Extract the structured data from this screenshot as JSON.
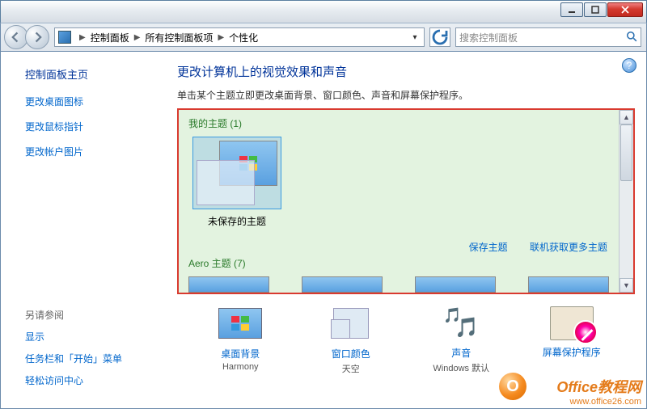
{
  "breadcrumb": {
    "root": "控制面板",
    "mid": "所有控制面板项",
    "leaf": "个性化"
  },
  "search": {
    "placeholder": "搜索控制面板"
  },
  "sidebar": {
    "title": "控制面板主页",
    "links": [
      "更改桌面图标",
      "更改鼠标指针",
      "更改帐户图片"
    ],
    "seeAlsoTitle": "另请参阅",
    "seeAlso": [
      "显示",
      "任务栏和「开始」菜单",
      "轻松访问中心"
    ]
  },
  "main": {
    "heading": "更改计算机上的视觉效果和声音",
    "sub": "单击某个主题立即更改桌面背景、窗口颜色、声音和屏幕保护程序。"
  },
  "themes": {
    "myThemesTitle": "我的主题 (1)",
    "unsavedLabel": "未保存的主题",
    "saveLink": "保存主题",
    "onlineLink": "联机获取更多主题",
    "aeroTitle": "Aero 主题 (7)"
  },
  "bottom": {
    "bg": {
      "label": "桌面背景",
      "value": "Harmony"
    },
    "color": {
      "label": "窗口颜色",
      "value": "天空"
    },
    "sound": {
      "label": "声音",
      "value": "Windows 默认"
    },
    "saver": {
      "label": "屏幕保护程序",
      "value": ""
    }
  },
  "watermark": {
    "brand": "Office教程网",
    "url": "www.office26.com",
    "logo": "O"
  }
}
